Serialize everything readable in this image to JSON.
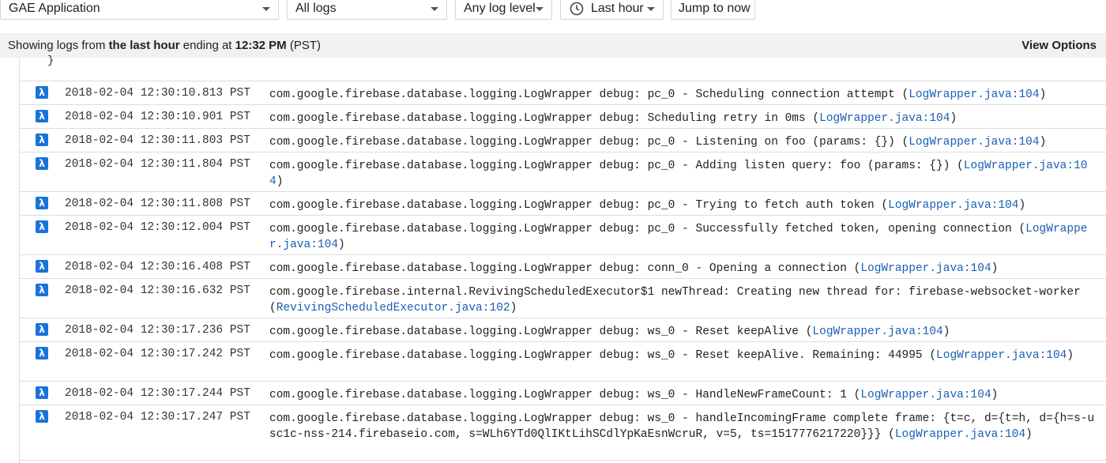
{
  "toolbar": {
    "resource": "GAE Application",
    "logs": "All logs",
    "level": "Any log level",
    "time_range": "Last hour",
    "jump": "Jump to now"
  },
  "infobar": {
    "prefix": "Showing logs from ",
    "range": "the last hour",
    "middle": " ending at ",
    "time": "12:32 PM",
    "tz": " (PST)",
    "view_options": "View Options"
  },
  "brace": "}",
  "severity_glyph": "λ",
  "colors": {
    "accent": "#1a73d9",
    "link": "#1a5fb4",
    "infobar_bg": "#f1f1f1"
  },
  "logs": [
    {
      "ts": "2018-02-04 12:30:10.813 PST",
      "msg": "com.google.firebase.database.logging.LogWrapper debug: pc_0 - Scheduling connection attempt (",
      "src": "LogWrapper.java:104",
      "end": ")"
    },
    {
      "ts": "2018-02-04 12:30:10.901 PST",
      "msg": "com.google.firebase.database.logging.LogWrapper debug: Scheduling retry in 0ms (",
      "src": "LogWrapper.java:104",
      "end": ")"
    },
    {
      "ts": "2018-02-04 12:30:11.803 PST",
      "msg": "com.google.firebase.database.logging.LogWrapper debug: pc_0 - Listening on foo (params: {}) (",
      "src": "LogWrapper.java:104",
      "end": ")"
    },
    {
      "ts": "2018-02-04 12:30:11.804 PST",
      "msg": "com.google.firebase.database.logging.LogWrapper debug: pc_0 - Adding listen query: foo (params: {}) (",
      "src": "LogWrapper.java:104",
      "end": ")"
    },
    {
      "ts": "2018-02-04 12:30:11.808 PST",
      "msg": "com.google.firebase.database.logging.LogWrapper debug: pc_0 - Trying to fetch auth token (",
      "src": "LogWrapper.java:104",
      "end": ")"
    },
    {
      "ts": "2018-02-04 12:30:12.004 PST",
      "msg": "com.google.firebase.database.logging.LogWrapper debug: pc_0 - Successfully fetched token, opening connection (",
      "src": "LogWrapper.java:104",
      "end": ")"
    },
    {
      "ts": "2018-02-04 12:30:16.408 PST",
      "msg": "com.google.firebase.database.logging.LogWrapper debug: conn_0 - Opening a connection (",
      "src": "LogWrapper.java:104",
      "end": ")"
    },
    {
      "ts": "2018-02-04 12:30:16.632 PST",
      "msg": "com.google.firebase.internal.RevivingScheduledExecutor$1 newThread: Creating new thread for: firebase-websocket-worker (",
      "src": "RevivingScheduledExecutor.java:102",
      "end": ")"
    },
    {
      "ts": "2018-02-04 12:30:17.236 PST",
      "msg": "com.google.firebase.database.logging.LogWrapper debug: ws_0 - Reset keepAlive (",
      "src": "LogWrapper.java:104",
      "end": ")"
    },
    {
      "ts": "2018-02-04 12:30:17.242 PST",
      "msg": "com.google.firebase.database.logging.LogWrapper debug: ws_0 - Reset keepAlive. Remaining: 44995 (",
      "src": "LogWrapper.java:104",
      "end": ")"
    },
    {
      "ts": "2018-02-04 12:30:17.244 PST",
      "msg": "com.google.firebase.database.logging.LogWrapper debug: ws_0 - HandleNewFrameCount: 1 (",
      "src": "LogWrapper.java:104",
      "end": ")"
    },
    {
      "ts": "2018-02-04 12:30:17.247 PST",
      "msg": "com.google.firebase.database.logging.LogWrapper debug: ws_0 - handleIncomingFrame complete frame: {t=c, d={t=h, d={h=s-usc1c-nss-214.firebaseio.com, s=WLh6YTd0QlIKtLihSCdlYpKaEsnWcruR, v=5, ts=1517776217220}}} (",
      "src": "LogWrapper.java:104",
      "end": ")"
    }
  ]
}
